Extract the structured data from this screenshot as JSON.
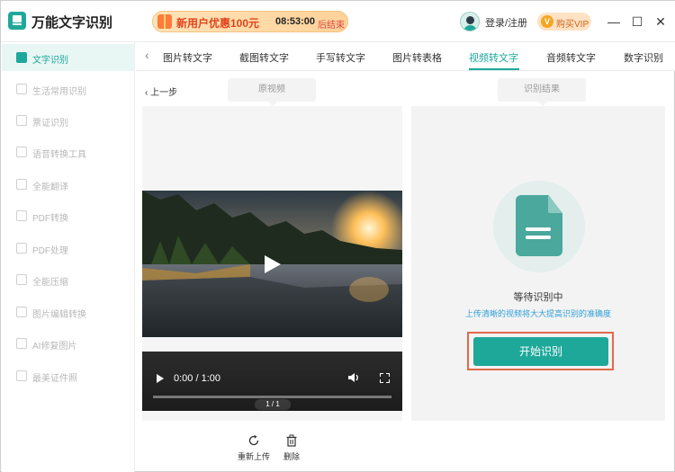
{
  "app": {
    "title": "万能文字识别"
  },
  "promo": {
    "text": "新用户优惠100元",
    "timer": "08:53:00",
    "end_label": "后结束"
  },
  "header": {
    "login_label": "登录/注册",
    "vip_label": "购买VIP",
    "vip_badge": "V"
  },
  "window_controls": {
    "minimize": "—",
    "maximize": "☐",
    "close": "✕"
  },
  "sidebar": {
    "items": [
      {
        "label": "文字识别",
        "icon": "text-scan-icon",
        "active": true
      },
      {
        "label": "生活常用识别",
        "icon": "scan-icon"
      },
      {
        "label": "票证识别",
        "icon": "ticket-icon"
      },
      {
        "label": "语音转换工具",
        "icon": "voice-icon"
      },
      {
        "label": "全能翻译",
        "icon": "translate-icon"
      },
      {
        "label": "PDF转换",
        "icon": "pdf-convert-icon"
      },
      {
        "label": "PDF处理",
        "icon": "pdf-process-icon"
      },
      {
        "label": "全能压缩",
        "icon": "compress-icon"
      },
      {
        "label": "图片编辑转换",
        "icon": "image-edit-icon"
      },
      {
        "label": "AI修复图片",
        "icon": "ai-repair-icon"
      },
      {
        "label": "最美证件照",
        "icon": "id-photo-icon"
      }
    ]
  },
  "tabs": {
    "items": [
      "图片转文字",
      "截图转文字",
      "手写转文字",
      "图片转表格",
      "视频转文字",
      "音频转文字",
      "数字识别"
    ],
    "active_index": 4
  },
  "workspace": {
    "back_label": "上一步",
    "left_header": "原视频",
    "right_header": "识别结果",
    "video_time": "0:00 / 1:00",
    "page_indicator": "1 / 1",
    "status": "等待识别中",
    "hint": "上传清晰的视频将大大提高识别的准确度",
    "start_button": "开始识别",
    "reupload_label": "重新上传",
    "delete_label": "删除"
  },
  "colors": {
    "accent": "#1ea89a",
    "highlight_outline": "#e06a4b",
    "hint_text": "#2f9fd6"
  }
}
